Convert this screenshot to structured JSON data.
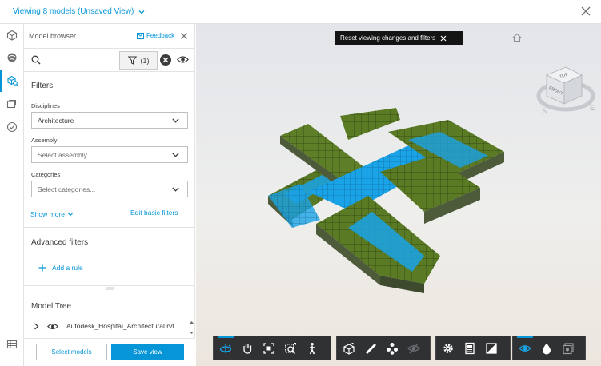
{
  "header": {
    "title": "Viewing 8 models (Unsaved View)"
  },
  "rail": {
    "items": [
      {
        "name": "models-icon"
      },
      {
        "name": "views-icon"
      },
      {
        "name": "model-browser-icon"
      },
      {
        "name": "issues-icon"
      },
      {
        "name": "checklist-icon"
      }
    ],
    "bottom_icon": "table-icon"
  },
  "panel": {
    "title": "Model browser",
    "feedback_label": "Feedback",
    "search": {
      "placeholder": "",
      "value": ""
    },
    "filter_count": "(1)",
    "filters_title": "Filters",
    "disciplines": {
      "label": "Disciplines",
      "value": "Architecture"
    },
    "assembly": {
      "label": "Assembly",
      "placeholder": "Select assembly..."
    },
    "categories": {
      "label": "Categories",
      "placeholder": "Select categories..."
    },
    "show_more": "Show more",
    "edit_basic_filters": "Edit basic filters",
    "advanced_title": "Advanced filters",
    "add_rule": "Add a rule",
    "model_tree_title": "Model Tree",
    "tree_items": [
      {
        "label": "Autodesk_Hospital_Architectural.rvt"
      }
    ],
    "select_models": "Select models",
    "save_view": "Save view"
  },
  "viewer": {
    "reset_banner": "Reset viewing changes and filters",
    "viewcube": {
      "top": "TOP",
      "front": "FRONT",
      "compass_south": "S",
      "compass_east": "E"
    }
  },
  "colors": {
    "accent": "#0696d7",
    "toolbar_bg": "#2f3133",
    "model_green": "#5a7a23",
    "model_blue": "#1aa3e6"
  },
  "toolbar": {
    "groups": [
      [
        "orbit-icon",
        "pan-icon",
        "fit-to-view-icon",
        "zoom-window-icon",
        "first-person-icon"
      ],
      [
        "section-box-icon",
        "measure-icon",
        "explode-icon",
        "ghosting-icon"
      ],
      [
        "settings-icon",
        "properties-icon",
        "fullscreen-icon"
      ],
      [
        "visibility-icon",
        "appearance-icon",
        "documents-icon"
      ]
    ]
  }
}
